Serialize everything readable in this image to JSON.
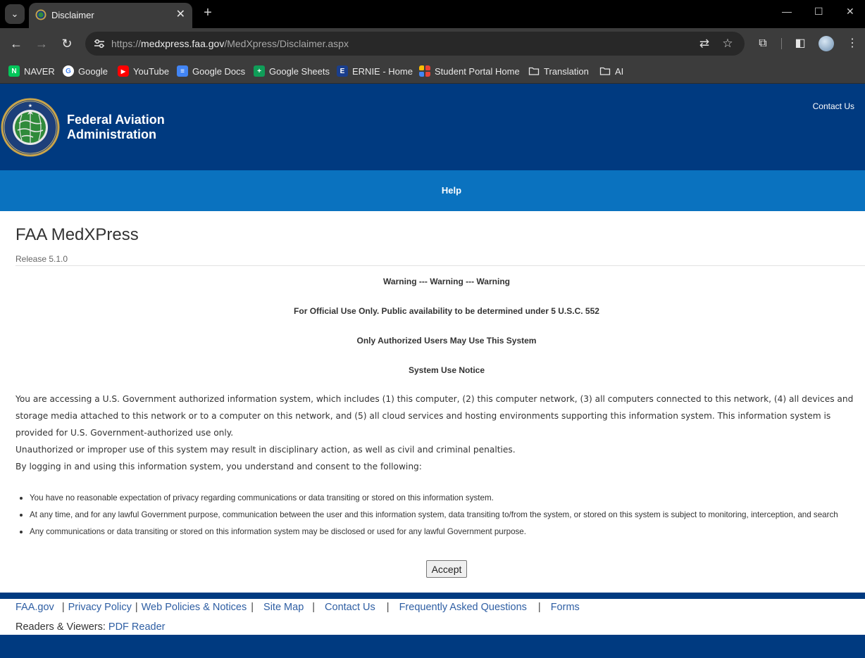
{
  "browser": {
    "tab": {
      "title": "Disclaimer"
    },
    "url": {
      "scheme": "https://",
      "host": "medxpress.faa.gov",
      "path": "/MedXpress/Disclaimer.aspx"
    },
    "bookmarks": [
      {
        "label": "NAVER",
        "icon": "naver-icon",
        "color": "#03c75a",
        "glyph": "N"
      },
      {
        "label": "Google",
        "icon": "google-icon",
        "color": "#ffffff",
        "glyph": "G"
      },
      {
        "label": "YouTube",
        "icon": "youtube-icon",
        "color": "#ff0000",
        "glyph": "▶"
      },
      {
        "label": "Google Docs",
        "icon": "google-docs-icon",
        "color": "#4285f4",
        "glyph": "≡"
      },
      {
        "label": "Google Sheets",
        "icon": "google-sheets-icon",
        "color": "#0f9d58",
        "glyph": "+"
      },
      {
        "label": "ERNIE - Home",
        "icon": "ernie-icon",
        "color": "#1a3e8c",
        "glyph": "E"
      },
      {
        "label": "Student Portal Home",
        "icon": "student-portal-icon",
        "color": "#ea4335",
        "glyph": ""
      },
      {
        "label": "Translation",
        "icon": "folder-icon",
        "color": "",
        "glyph": ""
      },
      {
        "label": "AI",
        "icon": "folder-icon",
        "color": "",
        "glyph": ""
      }
    ]
  },
  "header": {
    "org_line1": "Federal Aviation",
    "org_line2": "Administration",
    "contact": "Contact Us"
  },
  "nav": {
    "help": "Help"
  },
  "main": {
    "title": "FAA MedXPress",
    "release": "Release 5.1.0",
    "warnings": [
      "Warning --- Warning --- Warning",
      "For Official Use Only. Public availability to be determined under 5 U.S.C. 552",
      "Only Authorized Users May Use This System",
      "System Use Notice"
    ],
    "paragraph1": "You are accessing a U.S. Government authorized information system, which includes (1) this computer, (2) this computer network, (3) all computers connected to this network, (4) all devices and storage media attached to this network or to a computer on this network, and (5) all cloud services and hosting environments supporting this information system. This information system is provided for U.S. Government-authorized use only.",
    "paragraph2": "Unauthorized or improper use of this system may result in disciplinary action, as well as civil and criminal penalties.",
    "paragraph3": "By logging in and using this information system, you understand and consent to the following:",
    "bullets": [
      "You have no reasonable expectation of privacy regarding communications or data transiting or stored on this information system.",
      "At any time, and for any lawful Government purpose, communication between the user and this information system, data transiting to/from the system, or stored on this system is subject to monitoring, interception, and search",
      "Any communications or data transiting or stored on this information system may be disclosed or used for any lawful Government purpose."
    ],
    "accept": "Accept"
  },
  "footer": {
    "links": [
      "FAA.gov",
      "Privacy Policy",
      "Web Policies & Notices",
      "Site Map",
      "Contact Us",
      "Frequently Asked Questions",
      "Forms"
    ],
    "readers_label": "Readers & Viewers:",
    "pdf_reader": "PDF Reader"
  },
  "colors": {
    "faa_dark_blue": "#003a80",
    "faa_help_blue": "#0a72bf",
    "link_blue": "#2e5ea3"
  }
}
